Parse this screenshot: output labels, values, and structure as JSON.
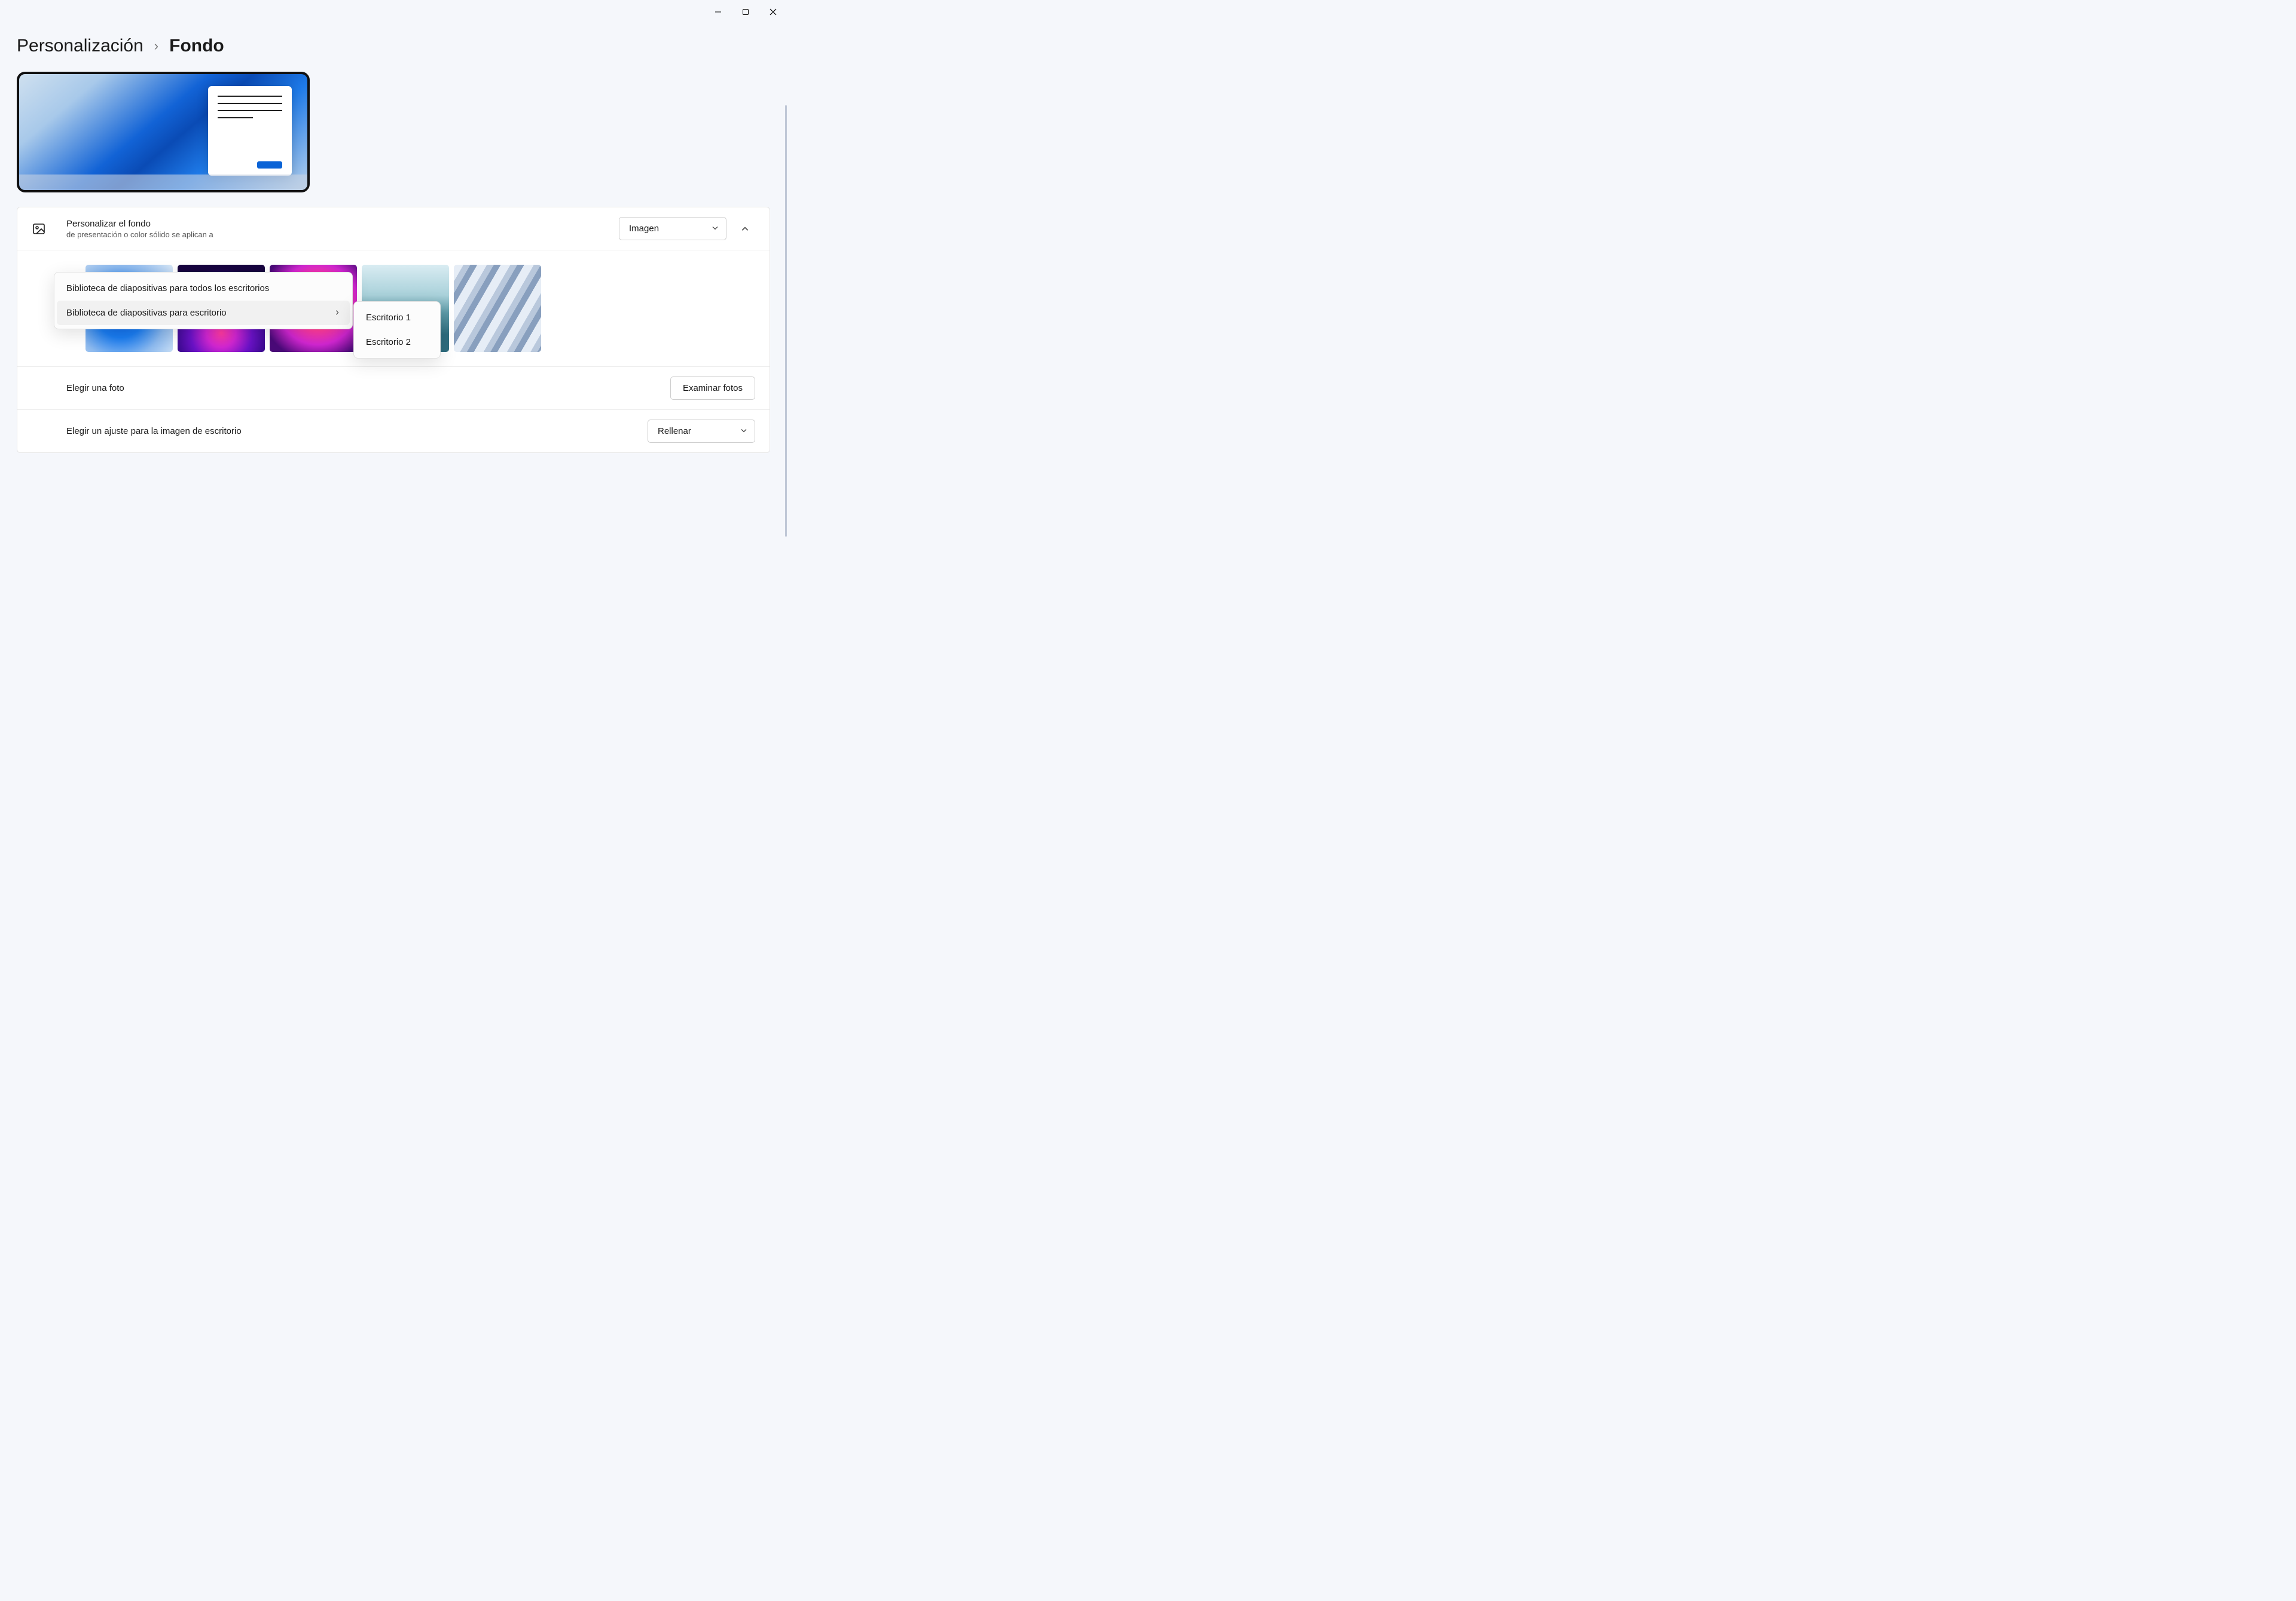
{
  "breadcrumb": {
    "parent": "Personalización",
    "current": "Fondo"
  },
  "customize_row": {
    "title": "Personalizar el fondo",
    "subtitle_visible": "de presentación o color sólido se aplican a",
    "select_value": "Imagen"
  },
  "context_menu": {
    "item_all": "Biblioteca de diapositivas para todos los escritorios",
    "item_per": "Biblioteca de diapositivas para escritorio",
    "submenu": {
      "d1": "Escritorio 1",
      "d2": "Escritorio 2"
    }
  },
  "choose_photo": {
    "label": "Elegir una foto",
    "button": "Examinar fotos"
  },
  "fit_row": {
    "label": "Elegir un ajuste para la imagen de escritorio",
    "select_value": "Rellenar"
  }
}
